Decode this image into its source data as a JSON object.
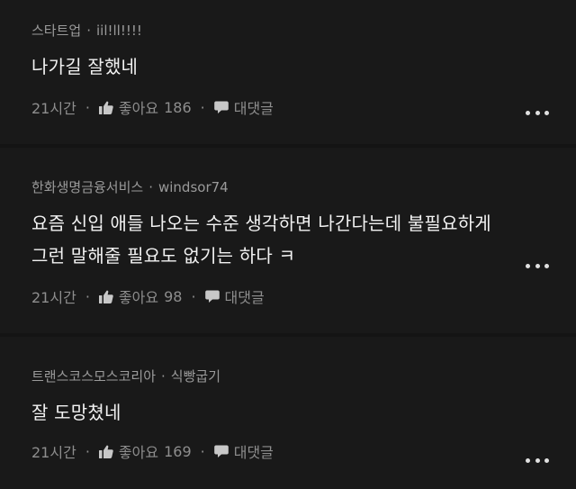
{
  "comments": [
    {
      "company": "스타트업",
      "separator": "·",
      "username": "iil!ll!!!!",
      "text_lines": [
        "나가길 잘했네"
      ],
      "time": "21시간",
      "like_label": "좋아요",
      "like_count": "186",
      "reply_label": "대댓글"
    },
    {
      "company": "한화생명금융서비스",
      "separator": "·",
      "username": "windsor74",
      "text_lines": [
        "요즘 신입 애들 나오는 수준 생각하면 나간다는데 불필요하게",
        "그런 말해줄 필요도 없기는 하다 ㅋ"
      ],
      "time": "21시간",
      "like_label": "좋아요",
      "like_count": "98",
      "reply_label": "대댓글"
    },
    {
      "company": "트랜스코스모스코리아",
      "separator": "·",
      "username": "식빵굽기",
      "text_lines": [
        "잘 도망쳤네"
      ],
      "time": "21시간",
      "like_label": "좋아요",
      "like_count": "169",
      "reply_label": "대댓글"
    }
  ],
  "action_separator": "·",
  "icons": {
    "like": "thumbs-up-icon",
    "reply": "speech-bubble-icon",
    "more": "more-dots-icon"
  },
  "colors": {
    "background": "#141414",
    "card": "#191919",
    "text_primary": "#f2f2f2",
    "text_secondary": "#9a9a9a"
  }
}
